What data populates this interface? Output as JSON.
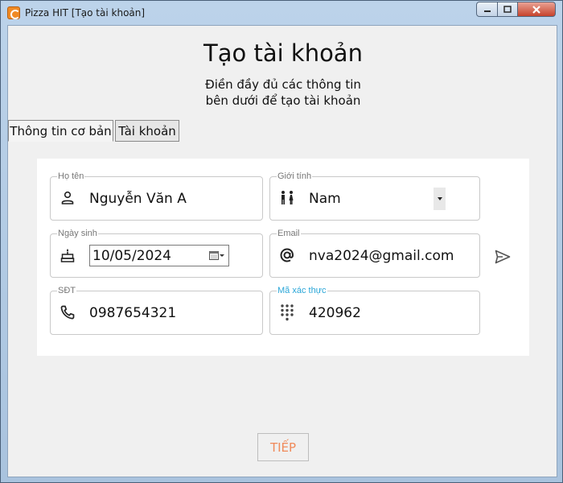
{
  "window": {
    "title": "Pizza HIT [Tạo tài khoản]",
    "app_icon": "pizza-app-icon",
    "min_glyph": "—",
    "close_glyph": "✕"
  },
  "header": {
    "title": "Tạo tài khoản",
    "subtitle_line1": "Điền đầy đủ các thông tin",
    "subtitle_line2": "bên dưới để tạo tài khoản"
  },
  "tabs": [
    {
      "label": "Thông tin cơ bản",
      "active": true
    },
    {
      "label": "Tài khoản",
      "active": false
    }
  ],
  "form": {
    "fullname": {
      "label": "Họ tên",
      "value": "Nguyễn Văn A",
      "icon": "person-icon"
    },
    "gender": {
      "label": "Giới tính",
      "value": "Nam",
      "icon": "gender-icon"
    },
    "birthday": {
      "label": "Ngày sinh",
      "value": "10/05/2024",
      "icon": "cake-icon"
    },
    "email": {
      "label": "Email",
      "value": "nva2024@gmail.com",
      "icon": "at-icon"
    },
    "phone": {
      "label": "SĐT",
      "value": "0987654321",
      "icon": "phone-icon"
    },
    "otp": {
      "label": "Mã xác thực",
      "value": "420962",
      "icon": "dialpad-icon"
    }
  },
  "actions": {
    "send_icon": "send-icon",
    "next_label": "TIẾP"
  },
  "colors": {
    "accent_orange": "#f08a5a",
    "focus_blue": "#2aa6d8",
    "panel_bg": "#ffffff",
    "client_bg": "#f0f0f0"
  }
}
